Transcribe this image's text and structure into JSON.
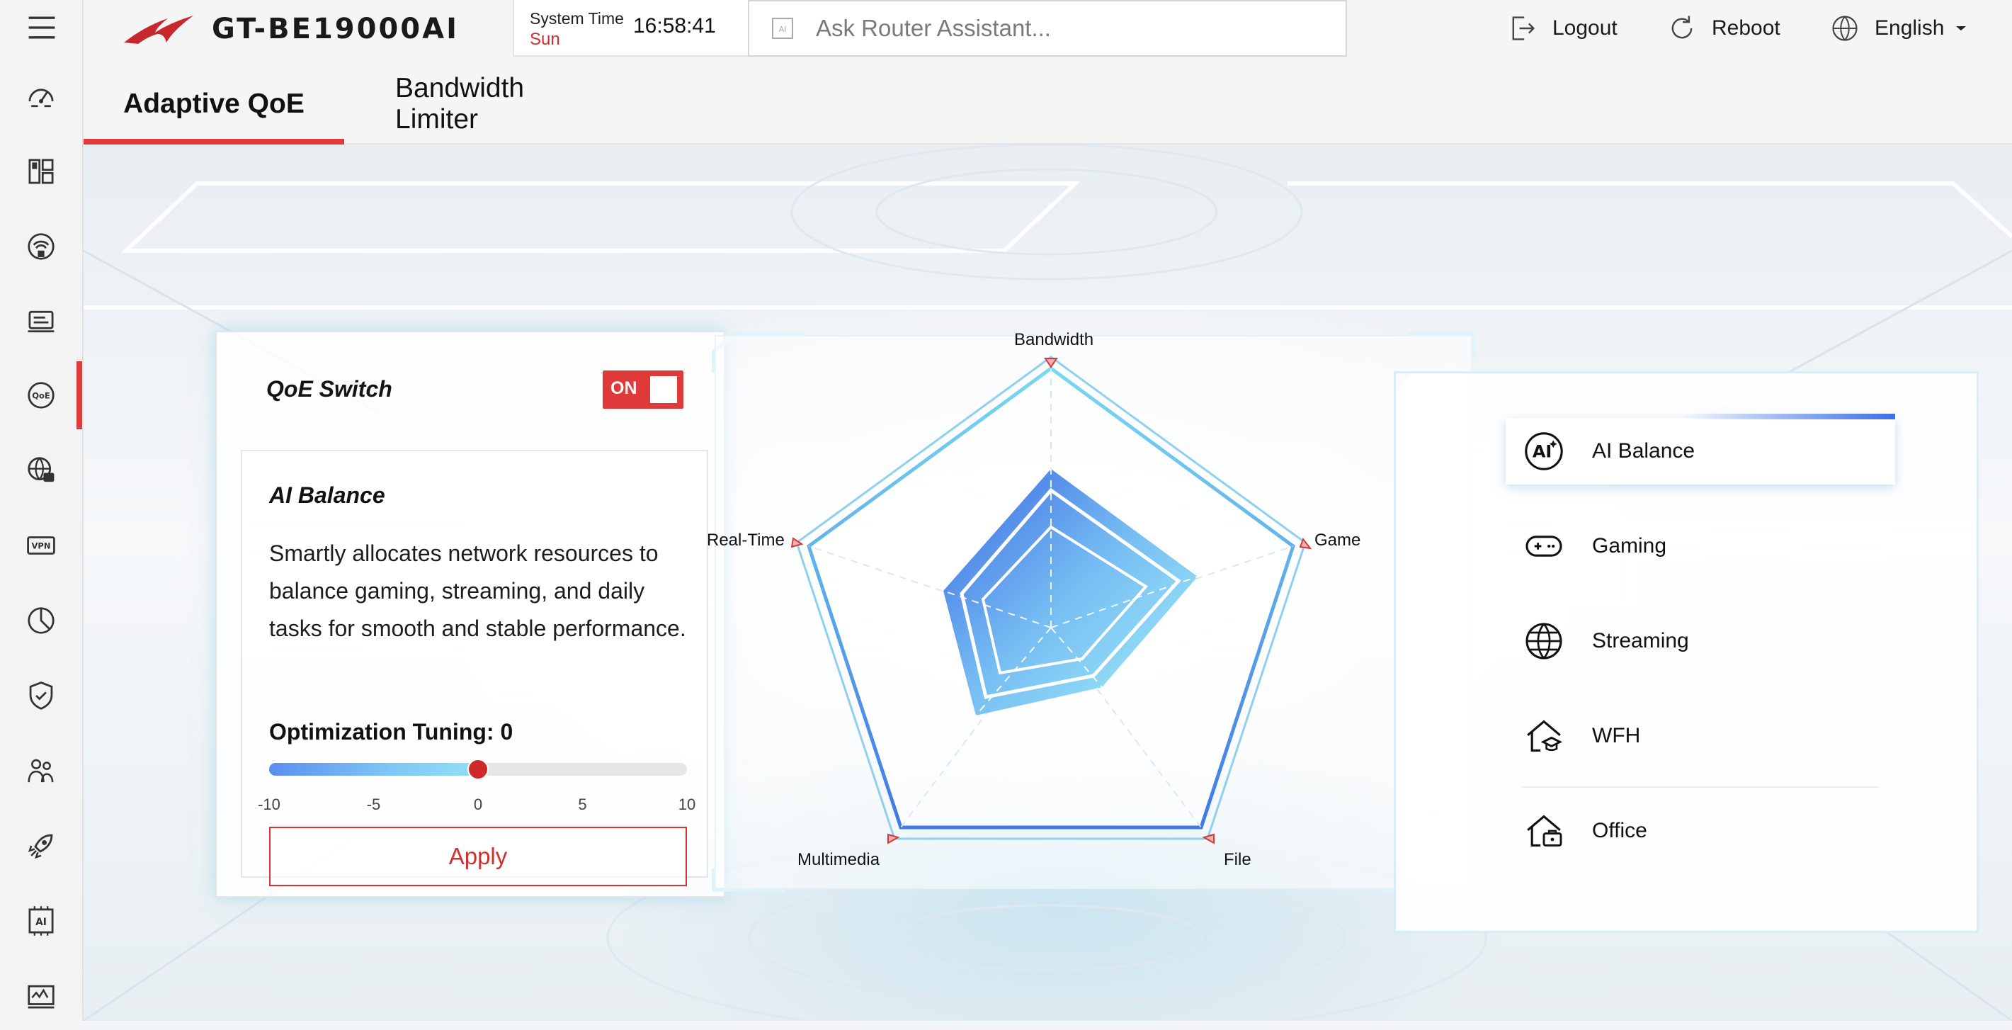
{
  "header": {
    "model": "GT-BE19000AI",
    "system_time_label": "System Time",
    "day": "Sun",
    "clock": "16:58:41",
    "assistant_placeholder": "Ask Router Assistant...",
    "logout": "Logout",
    "reboot": "Reboot",
    "language": "English"
  },
  "tabs": [
    {
      "label": "Adaptive QoE",
      "active": true
    },
    {
      "label": "Bandwidth Limiter",
      "active": false
    }
  ],
  "nav": [
    "dashboard-icon",
    "widgets-icon",
    "wifi-icon",
    "network-map-icon",
    "qoe-icon",
    "globe-lock-icon",
    "vpn-icon",
    "traffic-analyzer-icon",
    "security-icon",
    "family-icon",
    "game-boost-icon",
    "ai-icon",
    "system-log-icon"
  ],
  "qoe": {
    "switch_label": "QoE Switch",
    "switch_state": "ON",
    "mode_title": "AI Balance",
    "mode_description": "Smartly allocates network resources to balance gaming, streaming, and daily tasks for smooth and stable performance.",
    "tuning_label": "Optimization Tuning: 0",
    "tuning_value": 0,
    "tuning_min": -10,
    "tuning_max": 10,
    "ticks": [
      "-10",
      "-5",
      "0",
      "5",
      "10"
    ],
    "apply_label": "Apply"
  },
  "radar": {
    "axes": [
      "Bandwidth",
      "Game",
      "File",
      "Multimedia",
      "Real-Time"
    ]
  },
  "modes": [
    {
      "label": "AI Balance",
      "icon": "ai-balance-icon",
      "active": true
    },
    {
      "label": "Gaming",
      "icon": "gamepad-icon",
      "active": false
    },
    {
      "label": "Streaming",
      "icon": "globe-icon",
      "active": false
    },
    {
      "label": "WFH",
      "icon": "home-graduation-icon",
      "active": false
    },
    {
      "label": "Office",
      "icon": "home-briefcase-icon",
      "active": false
    }
  ],
  "colors": {
    "accent": "#e03a3a",
    "radar_blue": "#3b6fe6",
    "radar_cyan": "#7fe3f5"
  }
}
